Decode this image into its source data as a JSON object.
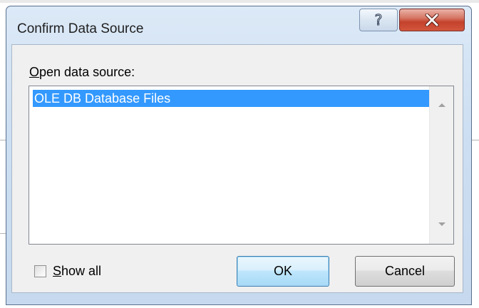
{
  "dialog": {
    "title": "Confirm Data Source",
    "help_icon": "help-icon",
    "close_icon": "close-icon"
  },
  "list": {
    "label": "Open data source:",
    "label_underlined": "O",
    "label_rest": "pen data source:",
    "items": [
      "OLE DB Database Files"
    ],
    "selected_index": 0
  },
  "show_all": {
    "label": "Show all",
    "label_underlined": "S",
    "label_rest": "how all",
    "checked": false
  },
  "buttons": {
    "ok": "OK",
    "cancel": "Cancel"
  },
  "colors": {
    "selection": "#3399ff",
    "close_button": "#c4412b"
  }
}
